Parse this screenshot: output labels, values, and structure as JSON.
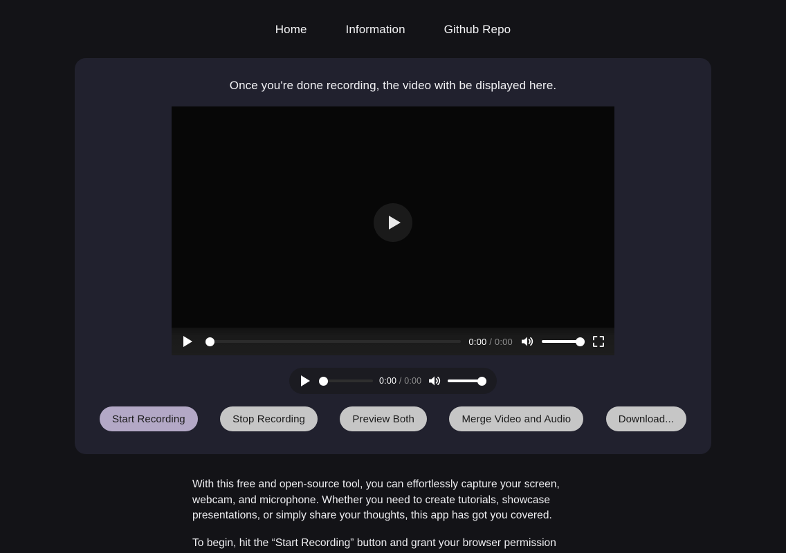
{
  "nav": {
    "items": [
      {
        "label": "Home"
      },
      {
        "label": "Information"
      },
      {
        "label": "Github Repo"
      }
    ]
  },
  "card": {
    "heading": "Once you're done recording, the video with be displayed here."
  },
  "video_player": {
    "play_overlay_icon": "play-icon",
    "play_button_icon": "play-icon",
    "current_time": "0:00",
    "separator": "/",
    "duration": "0:00",
    "volume_icon": "volume-high-icon",
    "fullscreen_icon": "fullscreen-icon",
    "progress_percent": 0,
    "volume_percent": 100
  },
  "audio_player": {
    "play_button_icon": "play-icon",
    "current_time": "0:00",
    "separator": "/",
    "duration": "0:00",
    "volume_icon": "volume-high-icon",
    "progress_percent": 0,
    "volume_percent": 100
  },
  "buttons": [
    {
      "label": "Start Recording",
      "style": "accent"
    },
    {
      "label": "Stop Recording",
      "style": "default"
    },
    {
      "label": "Preview Both",
      "style": "default"
    },
    {
      "label": "Merge Video and Audio",
      "style": "default"
    },
    {
      "label": "Download...",
      "style": "default"
    }
  ],
  "description": {
    "paragraph_1": "With this free and open-source tool, you can effortlessly capture your screen, webcam, and microphone. Whether you need to create tutorials, showcase presentations, or simply share your thoughts, this app has got you covered.",
    "paragraph_2": "To begin, hit the “Start Recording” button and grant your browser permission"
  },
  "colors": {
    "page_background": "#131317",
    "card_background": "#21212e",
    "accent_button": "#b3a8c6",
    "default_button": "#c6c6c6",
    "video_background": "#070707"
  }
}
